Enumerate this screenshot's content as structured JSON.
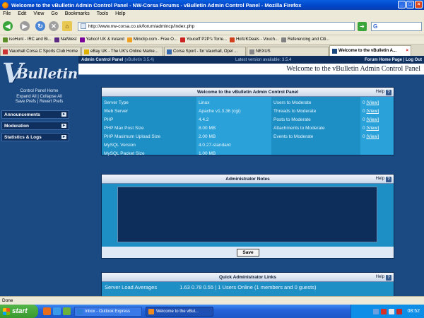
{
  "window": {
    "title": "Welcome to the vBulletin Admin Control Panel - NW-Corsa Forums - vBulletin Admin Control Panel - Mozilla Firefox"
  },
  "menu": [
    "File",
    "Edit",
    "View",
    "Go",
    "Bookmarks",
    "Tools",
    "Help"
  ],
  "address": {
    "url": "http://www.nw-corsa.co.uk/forum/admincp/index.php",
    "search_logo": "G"
  },
  "bookmarks": [
    {
      "label": "isoHunt - IRC and Bi...",
      "color": "#5b8e2a"
    },
    {
      "label": "NatWest",
      "color": "#5a2a85"
    },
    {
      "label": "Yahoo! UK & Ireland",
      "color": "#7b0099"
    },
    {
      "label": "Miniclip.com - Free O...",
      "color": "#f0a020"
    },
    {
      "label": "Youceff P2P's Torre...",
      "color": "#cc2222"
    },
    {
      "label": "HotUKDeals - Vouch...",
      "color": "#d04020"
    },
    {
      "label": "Referencing and Citi...",
      "color": "#808080"
    }
  ],
  "tabs": [
    {
      "label": "Vauxhall Corsa C Sports Club Home",
      "color": "#cc3333",
      "active": false
    },
    {
      "label": "eBay UK - The UK's Online Marke...",
      "color": "#e0b000",
      "active": false
    },
    {
      "label": "Corsa Sport - for Vauxhall, Opel ...",
      "color": "#3a6bb0",
      "active": false
    },
    {
      "label": "NEXUS",
      "color": "#888888",
      "active": false
    },
    {
      "label": "Welcome to the vBulletin A...",
      "color": "#1b4a83",
      "active": true
    }
  ],
  "acp": {
    "header_title": "Admin Control Panel",
    "header_version": "(vBulletin 3.5.4)",
    "latest_version": "Latest version available: 3.5.4",
    "forum_home_link": "Forum Home Page",
    "log_out_link": "Log Out",
    "link_sep": "|",
    "welcome": "Welcome to the vBulletin Admin Control Panel"
  },
  "sidebar": {
    "logo_text": "Bulletin",
    "logo_v": "V",
    "control_panel_home": "Control Panel Home",
    "expand_all": "Expand All",
    "collapse_all": "Collapse All",
    "save_prefs": "Save Prefs",
    "revert_prefs": "Revert Prefs",
    "sep": "|",
    "sections": [
      "Announcements",
      "Moderation",
      "Statistics & Logs"
    ]
  },
  "sysinfo": {
    "title": "Welcome to the vBulletin Admin Control Panel",
    "help": "Help",
    "labels": [
      "Server Type",
      "Web Server",
      "PHP",
      "PHP Max Post Size",
      "PHP Maximum Upload Size",
      "MySQL Version",
      "MySQL Packet Size"
    ],
    "values": [
      "Linux",
      "Apache v1.3.36 (cgi)",
      "4.4.2",
      "8.00 MB",
      "2.00 MB",
      "4.0.27-standard",
      "1.00 MB"
    ],
    "mod_labels": [
      "Users to Moderate",
      "Threads to Moderate",
      "Posts to Moderate",
      "Attachments to Moderate",
      "Events to Moderate"
    ],
    "mod_counts": [
      "0",
      "0",
      "0",
      "0",
      "0"
    ],
    "view_label": "[View]"
  },
  "notes": {
    "title": "Administrator Notes",
    "help": "Help",
    "save_label": "Save"
  },
  "quick": {
    "title": "Quick Administrator Links",
    "help": "Help",
    "load_label": "Server Load Averages",
    "load_values": "1.63  0.78  0.55",
    "online": "| 1 Users Online (1 members and 0 guests)"
  },
  "status": "Done",
  "taskbar": {
    "start": "start",
    "tasks": [
      {
        "label": "Inbox - Outlook Express",
        "color": "#2f7bd8",
        "active": false
      },
      {
        "label": "Welcome to the vBul...",
        "color": "#f08a1c",
        "active": true
      }
    ],
    "clock": "08:52"
  }
}
